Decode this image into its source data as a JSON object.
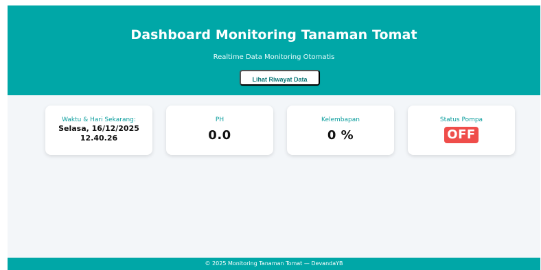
{
  "header": {
    "title": "Dashboard Monitoring Tanaman Tomat",
    "subtitle": "Realtime Data Monitoring Otomatis",
    "history_button_label": "Lihat Riwayat Data"
  },
  "cards": {
    "datetime": {
      "label": "Waktu & Hari Sekarang:",
      "date": "Selasa, 16/12/2025",
      "time": "12.40.26"
    },
    "ph": {
      "label": "PH",
      "value": "0.0"
    },
    "humidity": {
      "label": "Kelembapan",
      "value": "0 %"
    },
    "pump": {
      "label": "Status Pompa",
      "value": "OFF"
    }
  },
  "footer": {
    "text": "© 2025 Monitoring Tanaman Tomat — DevandaYB"
  },
  "colors": {
    "primary": "#00a7a7",
    "background": "#f3f6f9",
    "status_off": "#ef4d4a"
  }
}
